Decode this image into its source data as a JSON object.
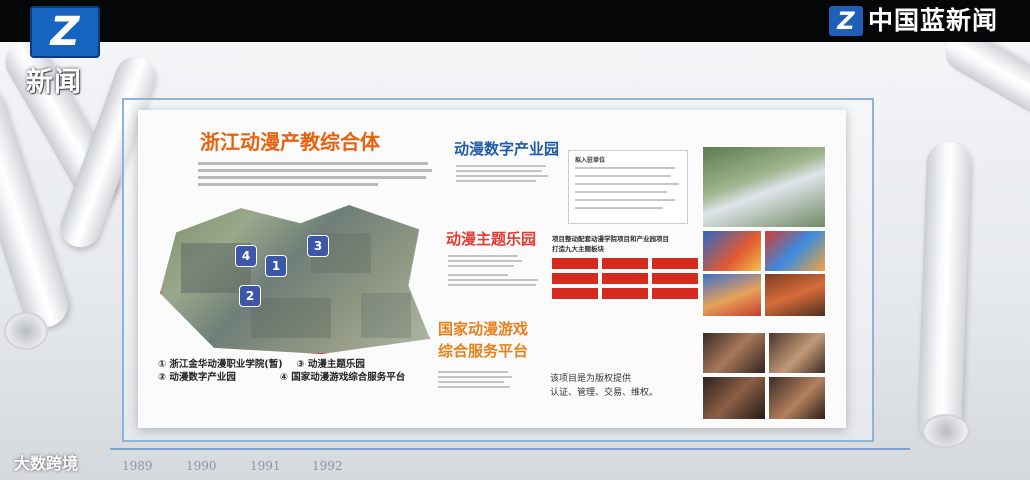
{
  "broadcast": {
    "logo_mark": "Z",
    "logo_label": "新闻",
    "brand_mark": "Z",
    "brand_name": "中国蓝新闻",
    "watermark": "大数跨境",
    "years": [
      "1989",
      "1990",
      "1991",
      "1992"
    ]
  },
  "board": {
    "title": "浙江动漫产教综合体",
    "map_markers": [
      "1",
      "2",
      "3",
      "4"
    ],
    "legend": [
      {
        "num": "①",
        "text": "浙江金华动漫职业学院(暂)"
      },
      {
        "num": "③",
        "text": "动漫主题乐园"
      },
      {
        "num": "②",
        "text": "动漫数字产业园"
      },
      {
        "num": "④",
        "text": "国家动漫游戏综合服务平台"
      }
    ],
    "sections": {
      "digital_park": {
        "title": "动漫数字产业园",
        "units_heading": "拟入驻单位"
      },
      "theme_park": {
        "title": "动漫主题乐园",
        "description": [
          "项目整动配套动漫学院项目和产业园项目",
          "打造九大主题板块"
        ]
      },
      "game_platform": {
        "title_line1": "国家动漫游戏",
        "title_line2": "综合服务平台",
        "description": [
          "该项目是为版权提供",
          "认证、管理、交易、维权。"
        ]
      }
    }
  },
  "colors": {
    "title_orange": "#e8620e",
    "digital_blue": "#1f5aa6",
    "theme_red": "#e23a2f",
    "game_orange": "#e8801a",
    "brand_blue": "#1565c0"
  }
}
